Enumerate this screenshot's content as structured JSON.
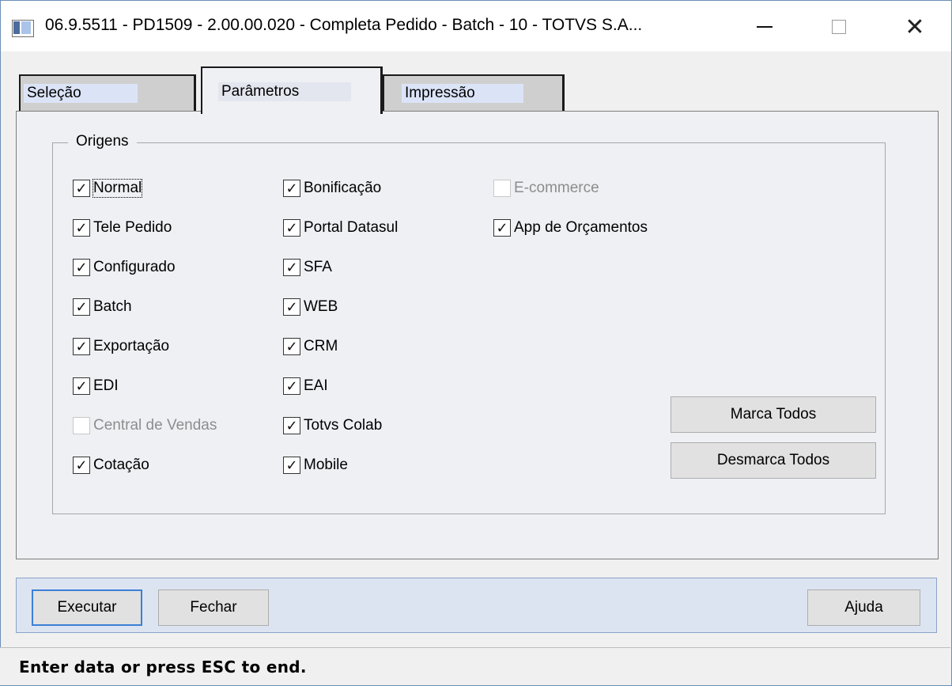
{
  "window": {
    "title": "06.9.5511 - PD1509 - 2.00.00.020 - Completa Pedido - Batch - 10 - TOTVS S.A...",
    "minimize_glyph": "—",
    "maximize_glyph": "☐",
    "close_glyph": "✕"
  },
  "tabs": [
    {
      "label": "Seleção"
    },
    {
      "label": "Parâmetros"
    },
    {
      "label": "Impressão"
    }
  ],
  "origens": {
    "legend": "Origens",
    "checkboxes": [
      {
        "label": "Normal",
        "checked": true,
        "enabled": true
      },
      {
        "label": "Tele Pedido",
        "checked": true,
        "enabled": true
      },
      {
        "label": "Configurado",
        "checked": true,
        "enabled": true
      },
      {
        "label": "Batch",
        "checked": true,
        "enabled": true
      },
      {
        "label": "Exportação",
        "checked": true,
        "enabled": true
      },
      {
        "label": "EDI",
        "checked": true,
        "enabled": true
      },
      {
        "label": "Central de Vendas",
        "checked": false,
        "enabled": false
      },
      {
        "label": "Cotação",
        "checked": true,
        "enabled": true
      },
      {
        "label": "Bonificação",
        "checked": true,
        "enabled": true
      },
      {
        "label": "Portal Datasul",
        "checked": true,
        "enabled": true
      },
      {
        "label": "SFA",
        "checked": true,
        "enabled": true
      },
      {
        "label": "WEB",
        "checked": true,
        "enabled": true
      },
      {
        "label": "CRM",
        "checked": true,
        "enabled": true
      },
      {
        "label": "EAI",
        "checked": true,
        "enabled": true
      },
      {
        "label": "Totvs Colab",
        "checked": true,
        "enabled": true
      },
      {
        "label": "Mobile",
        "checked": true,
        "enabled": true
      },
      {
        "label": "E-commerce",
        "checked": false,
        "enabled": false
      },
      {
        "label": "App de Orçamentos",
        "checked": true,
        "enabled": true
      }
    ],
    "marca_todos": "Marca Todos",
    "desmarca_todos": "Desmarca Todos"
  },
  "buttons": {
    "executar": "Executar",
    "fechar": "Fechar",
    "ajuda": "Ajuda"
  },
  "status": "Enter data or press ESC to end."
}
